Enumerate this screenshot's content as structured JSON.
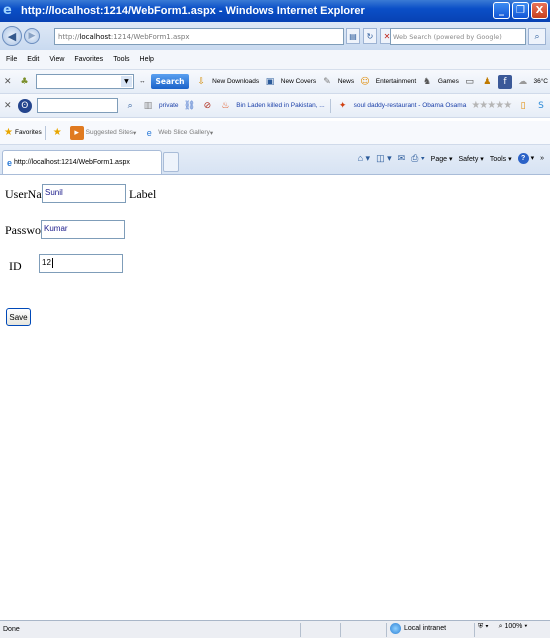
{
  "window": {
    "title": "http://localhost:1214/WebForm1.aspx - Windows Internet Explorer",
    "minimize_label": "_",
    "maximize_label": "❐",
    "close_label": "X"
  },
  "addressbar": {
    "url_prefix": "http://",
    "url_domain": "localhost",
    "url_rest": ":1214/WebForm1.aspx",
    "search_placeholder": "Web Search (powered by Google)"
  },
  "menu": {
    "items": [
      "File",
      "Edit",
      "View",
      "Favorites",
      "Tools",
      "Help"
    ]
  },
  "toolbar1": {
    "search_label": "Search",
    "new_downloads": "New Downloads",
    "new_covers": "New Covers",
    "news": "News",
    "entertainment": "Entertainment",
    "games": "Games",
    "temperature": "36°C"
  },
  "toolbar2": {
    "private_label": "private",
    "link1": "Bin Laden killed in Pakistan, ...",
    "link2": "soul daddy-restaurant - Obama Osama"
  },
  "favorites": {
    "label": "Favorites",
    "suggested": "Suggested Sites",
    "web_slice": "Web Slice Gallery"
  },
  "tab": {
    "title": "http://localhost:1214/WebForm1.aspx"
  },
  "commandbar": {
    "page": "Page",
    "safety": "Safety",
    "tools": "Tools"
  },
  "form": {
    "username_label": "UserName",
    "username_value": "Sunil",
    "label_text": "Label",
    "password_label": "Password",
    "password_value": "Kumar",
    "id_label": "ID",
    "id_value": "12",
    "save_label": "Save"
  },
  "status": {
    "text": "Done",
    "zone": "Local intranet",
    "zoom": "100%"
  }
}
